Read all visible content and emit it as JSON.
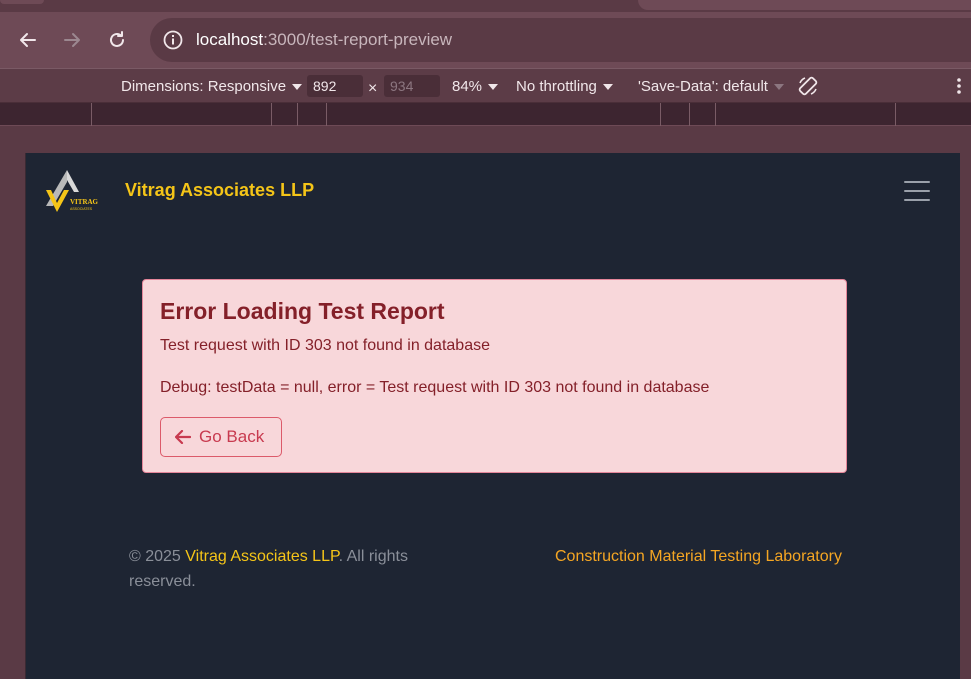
{
  "browser": {
    "url_host": "localhost",
    "url_path": ":3000/test-report-preview"
  },
  "devtools": {
    "dimensions_label": "Dimensions: Responsive",
    "width_value": "892",
    "times": "×",
    "height_value": "934",
    "zoom": "84%",
    "throttling": "No throttling",
    "save_data": "'Save-Data': default"
  },
  "page": {
    "brand": "Vitrag Associates LLP",
    "logo_text": "VITRAG",
    "logo_subtext": "ASSOCIATES",
    "error": {
      "title": "Error Loading Test Report",
      "message": "Test request with ID 303 not found in database",
      "debug": "Debug: testData = null, error = Test request with ID 303 not found in database",
      "back_button": "Go Back"
    },
    "footer": {
      "copyright_prefix": "© 2025 ",
      "copyright_brand": "Vitrag Associates LLP",
      "copyright_suffix": ". All rights reserved.",
      "tagline": "Construction Material Testing Laboratory"
    }
  },
  "colors": {
    "brand_yellow": "#f5c518",
    "tagline_orange": "#f5a623",
    "error_text": "#842029",
    "error_bg": "#f8d7da",
    "page_bg": "#1e2533"
  }
}
